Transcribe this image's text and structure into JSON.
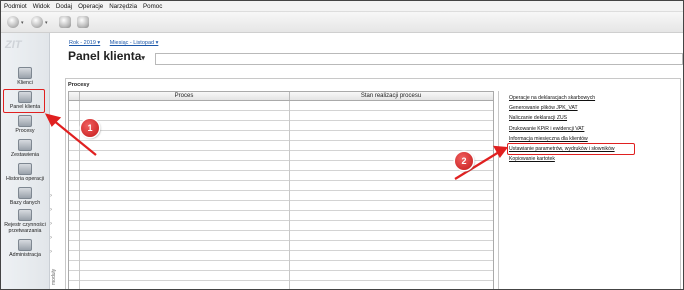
{
  "menu": [
    "Podmiot",
    "Widok",
    "Dodaj",
    "Operacje",
    "Narzędzia",
    "Pomoc"
  ],
  "logo_text": "ZIT",
  "sidebar": {
    "items": [
      {
        "label": "Klienci",
        "icon": "users-icon"
      },
      {
        "label": "Panel klienta",
        "icon": "panel-icon"
      },
      {
        "label": "Procesy",
        "icon": "process-icon"
      },
      {
        "label": "Zestawienia",
        "icon": "report-icon"
      },
      {
        "label": "Historia operacji",
        "icon": "history-icon"
      },
      {
        "label": "Bazy danych",
        "icon": "database-icon"
      },
      {
        "label": "Rejestr czynności przetwarzania",
        "icon": "register-icon"
      },
      {
        "label": "Administracja",
        "icon": "admin-icon"
      }
    ],
    "modules_label": "moduły"
  },
  "breadcrumb": {
    "year": "Rok - 2019 ▾",
    "month": "Miesiąc - Listopad ▾"
  },
  "page_title": "Panel klienta",
  "procesy_label": "Procesy",
  "table": {
    "headers": [
      "Proces",
      "Stan realizacji procesu"
    ],
    "rows": 18
  },
  "links": [
    "Operacje na deklaracjach skarbowych",
    "Generowanie plików JPK_VAT",
    "Naliczanie deklaracji ZUS",
    "Drukowanie KPiR i ewidencji VAT",
    "Informacja miesięczna dla klientów",
    "Ustawianie parametrów, wydruków i słowników",
    "Kopiowanie kartotek"
  ],
  "annotations": {
    "badge1": "1",
    "badge2": "2",
    "color": "#e02020"
  }
}
